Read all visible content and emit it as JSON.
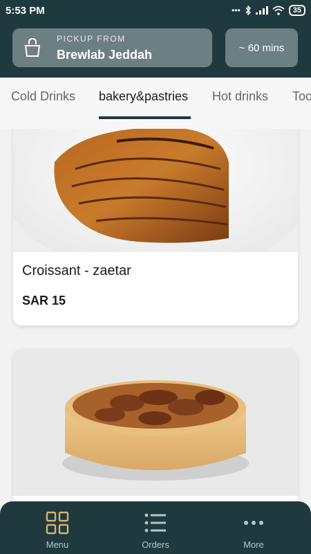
{
  "status": {
    "time": "5:53 PM",
    "battery": "35",
    "dots": "•••"
  },
  "header": {
    "pickup_label": "PICKUP FROM",
    "store_name": "Brewlab Jeddah",
    "eta": "~ 60 mins"
  },
  "tabs": [
    {
      "label": "Cold Drinks"
    },
    {
      "label": "bakery&pastries"
    },
    {
      "label": "Hot drinks"
    },
    {
      "label": "Too"
    }
  ],
  "active_tab": "bakery&pastries",
  "items": [
    {
      "title": "Croissant - zaetar",
      "price": "SAR 15"
    }
  ],
  "bottom_nav": [
    {
      "label": "Menu",
      "icon": "grid-icon"
    },
    {
      "label": "Orders",
      "icon": "list-icon"
    },
    {
      "label": "More",
      "icon": "more-dots-icon"
    }
  ],
  "colors": {
    "primary": "#1f3a3e",
    "chip": "#6c7f82",
    "background": "#f2f2f2"
  }
}
